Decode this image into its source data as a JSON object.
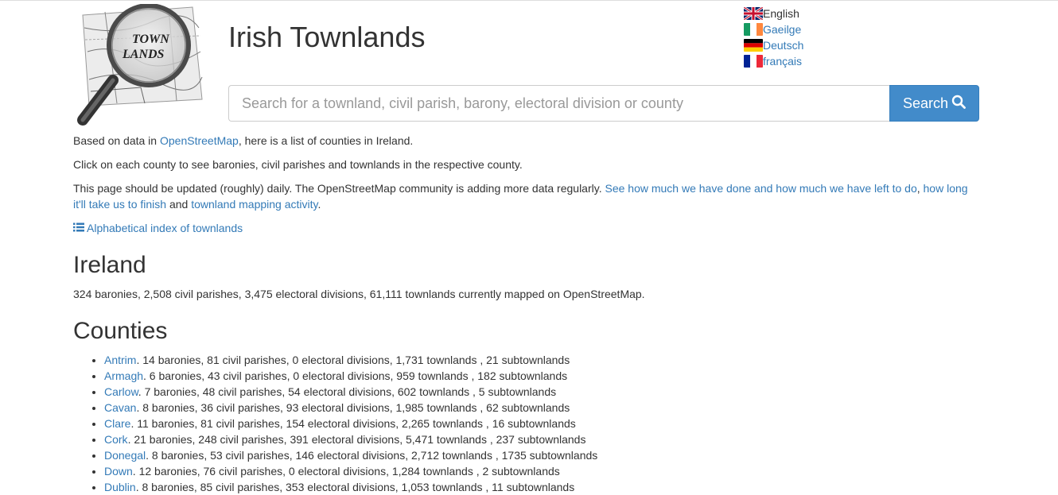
{
  "header": {
    "title": "Irish Townlands"
  },
  "languages": [
    {
      "label": "English",
      "current": true,
      "flag": "uk"
    },
    {
      "label": "Gaeilge",
      "current": false,
      "flag": "ie"
    },
    {
      "label": "Deutsch",
      "current": false,
      "flag": "de"
    },
    {
      "label": "français",
      "current": false,
      "flag": "fr"
    }
  ],
  "search": {
    "placeholder": "Search for a townland, civil parish, barony, electoral division or county",
    "button_label": "Search",
    "button_icon": "search-icon"
  },
  "intro": {
    "p1_prefix": "Based on data in ",
    "p1_link": "OpenStreetMap",
    "p1_suffix": ", here is a list of counties in Ireland.",
    "p2": "Click on each county to see baronies, civil parishes and townlands in the respective county.",
    "p3_text": "This page should be updated (roughly) daily. The OpenStreetMap community is adding more data regularly. ",
    "p3_link1": "See how much we have done and how much we have left to do",
    "p3_sep1": ", ",
    "p3_link2": "how long it'll take us to finish",
    "p3_sep2": " and ",
    "p3_link3": "townland mapping activity",
    "p3_end": ".",
    "index_link": "Alphabetical index of townlands"
  },
  "ireland": {
    "heading": "Ireland",
    "summary": "324 baronies, 2,508 civil parishes, 3,475 electoral divisions, 61,111 townlands currently mapped on OpenStreetMap."
  },
  "counties": {
    "heading": "Counties",
    "items": [
      {
        "name": "Antrim",
        "stats": " 14 baronies, 81 civil parishes, 0 electoral divisions, 1,731 townlands , 21 subtownlands"
      },
      {
        "name": "Armagh",
        "stats": " 6 baronies, 43 civil parishes, 0 electoral divisions, 959 townlands , 182 subtownlands"
      },
      {
        "name": "Carlow",
        "stats": " 7 baronies, 48 civil parishes, 54 electoral divisions, 602 townlands , 5 subtownlands"
      },
      {
        "name": "Cavan",
        "stats": " 8 baronies, 36 civil parishes, 93 electoral divisions, 1,985 townlands , 62 subtownlands"
      },
      {
        "name": "Clare",
        "stats": " 11 baronies, 81 civil parishes, 154 electoral divisions, 2,265 townlands , 16 subtownlands"
      },
      {
        "name": "Cork",
        "stats": " 21 baronies, 248 civil parishes, 391 electoral divisions, 5,471 townlands , 237 subtownlands"
      },
      {
        "name": "Donegal",
        "stats": " 8 baronies, 53 civil parishes, 146 electoral divisions, 2,712 townlands , 1735 subtownlands"
      },
      {
        "name": "Down",
        "stats": " 12 baronies, 76 civil parishes, 0 electoral divisions, 1,284 townlands , 2 subtownlands"
      },
      {
        "name": "Dublin",
        "stats": " 8 baronies, 85 civil parishes, 353 electoral divisions, 1,053 townlands , 11 subtownlands"
      }
    ]
  },
  "colors": {
    "link": "#337ab7",
    "button": "#428bca",
    "text": "#333333"
  }
}
